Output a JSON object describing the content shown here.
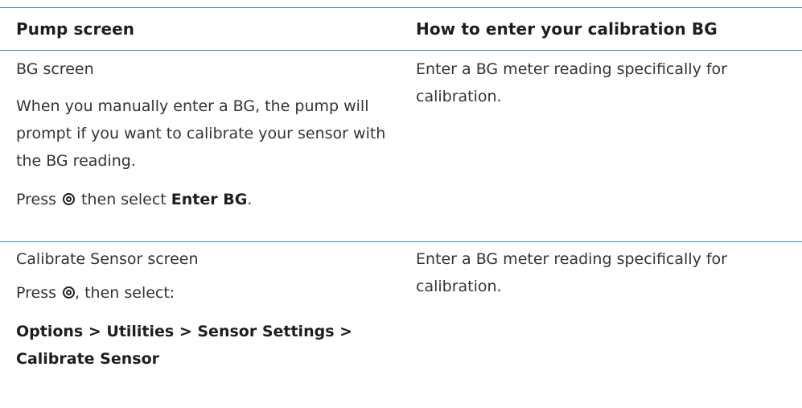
{
  "table": {
    "headers": [
      "Pump screen",
      "How to enter your calibration BG"
    ],
    "rows": [
      {
        "screen_name": "BG screen",
        "note": "When you manually enter a BG, the pump will prompt if you want to calibrate your sensor with the BG reading.",
        "press_prefix": "Press",
        "press_suffix": "then select",
        "press_target": "Enter BG",
        "press_end": ".",
        "how_to": "Enter a BG meter reading specifically for calibration."
      },
      {
        "screen_name": "Calibrate Sensor screen",
        "press_prefix": "Press",
        "press_suffix": ", then select:",
        "menu_path": "Options > Utilities > Sensor Settings > Calibrate Sensor",
        "how_to": "Enter a BG meter reading specifically for calibration."
      }
    ]
  },
  "icons": {
    "select_button": "select-button-icon"
  },
  "colors": {
    "rule": "#2f8fcf",
    "text": "#333333"
  }
}
